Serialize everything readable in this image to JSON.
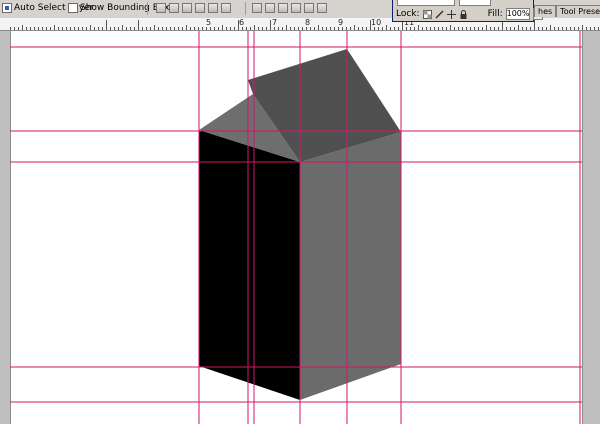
{
  "options_bar": {
    "auto_select": {
      "label": "Auto Select Layer",
      "checked": true
    },
    "bounding_box": {
      "label": "Show Bounding Box",
      "checked": false
    }
  },
  "ruler": {
    "labels": [
      "5",
      "6",
      "7",
      "8",
      "9",
      "10",
      "11"
    ]
  },
  "layers_panel": {
    "lock_label": "Lock:",
    "fill_label": "Fill:",
    "fill_value": "100%",
    "fill_arrow": "▸"
  },
  "panel_tabs": [
    "hes",
    "Tool Presets"
  ],
  "colors": {
    "guide": "#d4146a",
    "front_face": "#000000",
    "right_face": "#6b6b6b",
    "roof_left": "#6e6e6e",
    "roof_right": "#505050"
  }
}
